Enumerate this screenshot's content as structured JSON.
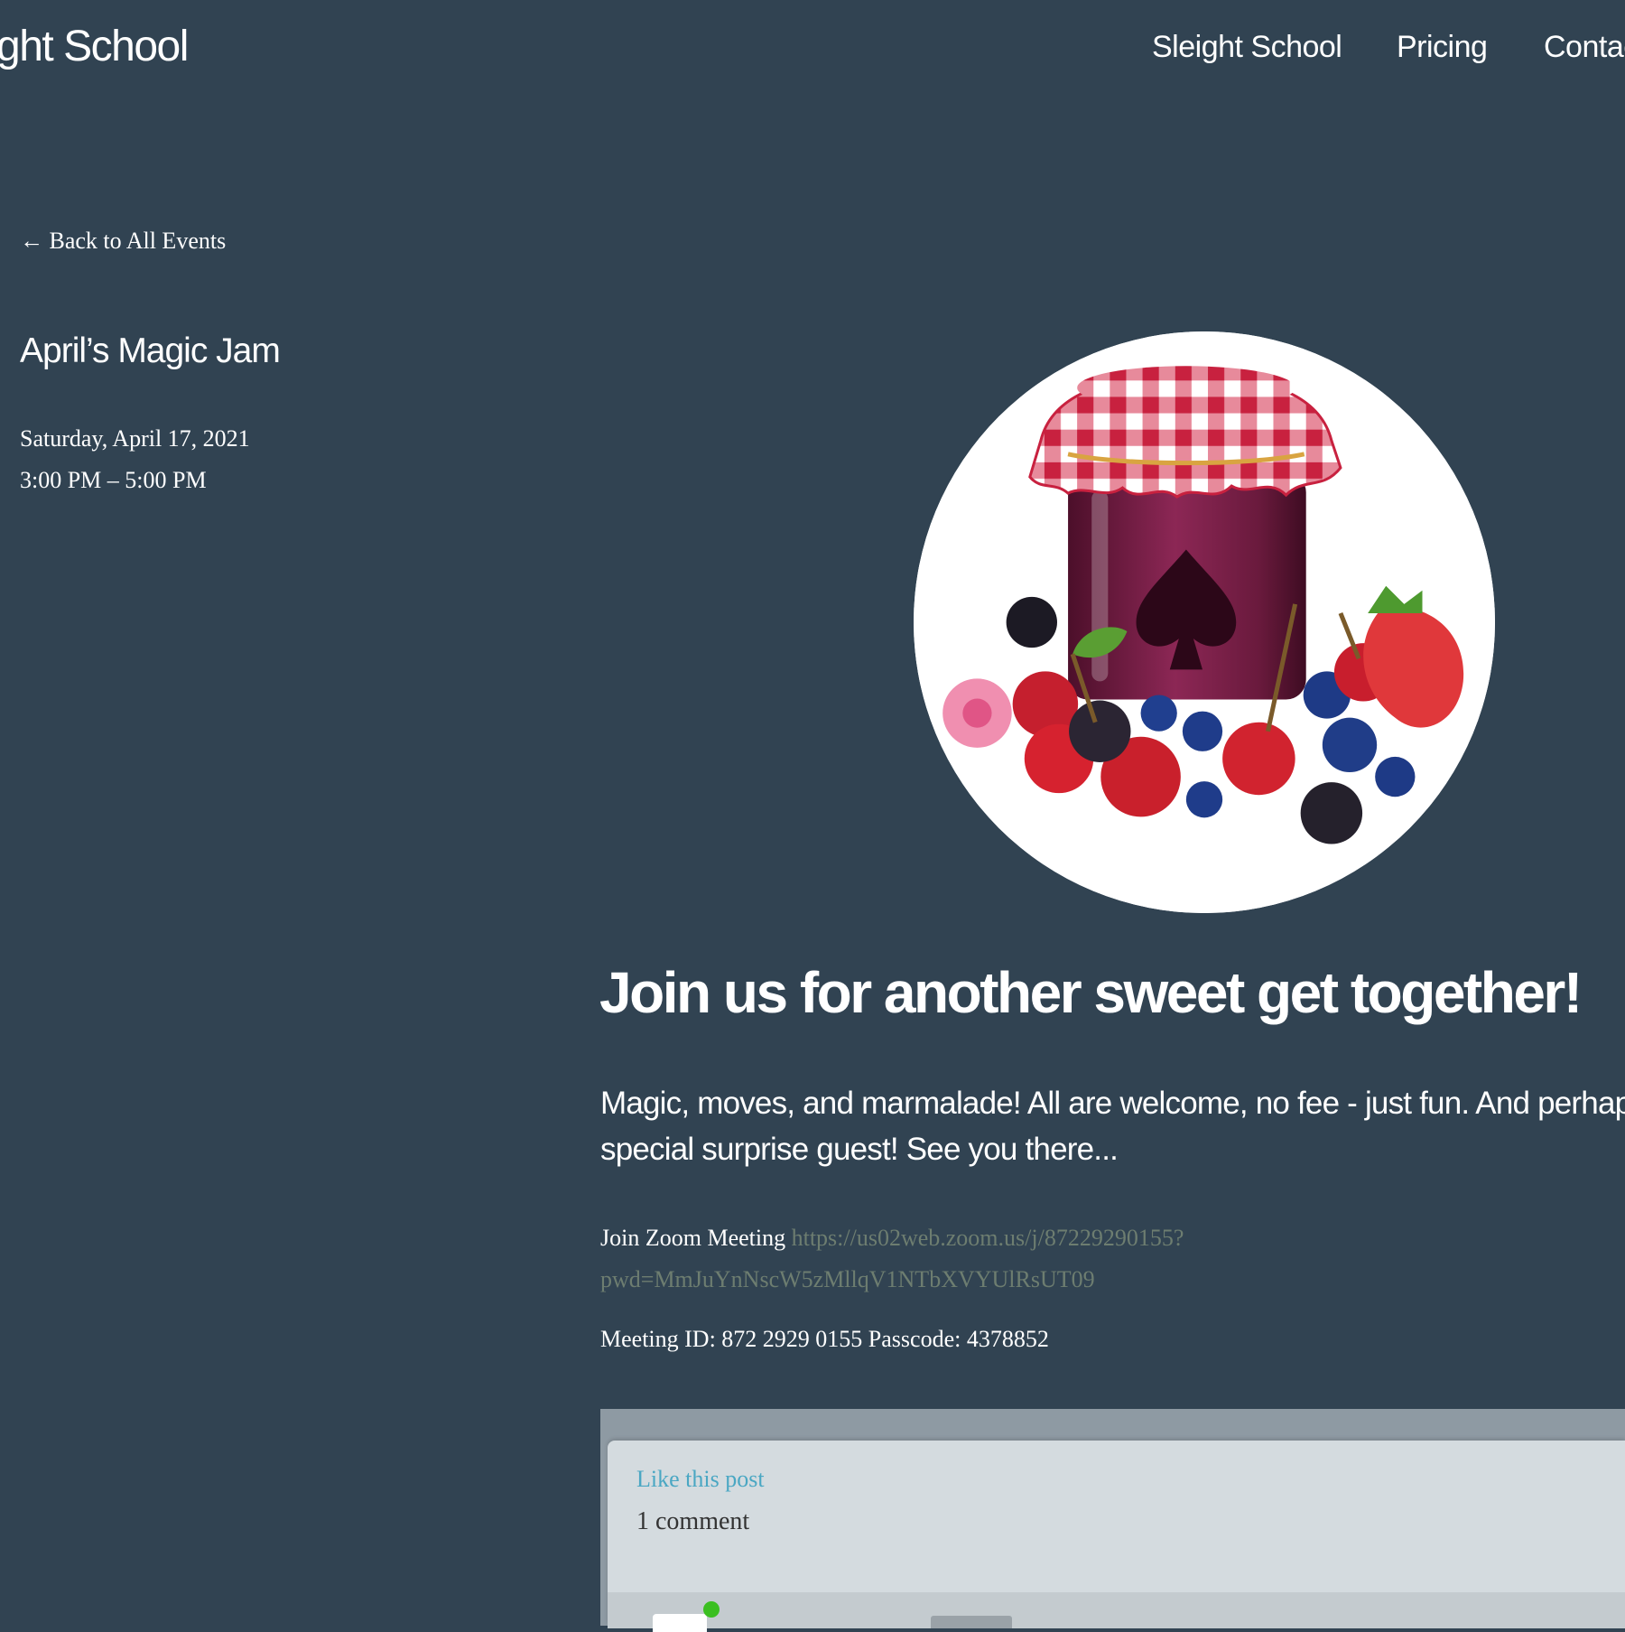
{
  "header": {
    "logo": "Sleight School",
    "nav": [
      "Sleight School",
      "Pricing",
      "Contact"
    ]
  },
  "event": {
    "back_link": "← Back to All Events",
    "title": "April’s Magic Jam",
    "date": "Saturday, April 17, 2021",
    "time": "3:00 PM – 5:00 PM"
  },
  "hero_image": {
    "icon": "jam-jar-spade-icon"
  },
  "content": {
    "heading": "Join us for another sweet get together!",
    "intro": "Magic, moves, and marmalade! All are welcome, no fee - just fun. And perhaps a special surprise guest! See you there...",
    "zoom_label": "Join Zoom Meeting",
    "zoom_url": "https://us02web.zoom.us/j/87229290155?pwd=MmJuYnNscW5zMllqV1NTbXVYUlRsUT09",
    "meeting_info": "Meeting ID: 872 2929 0155 Passcode: 4378852"
  },
  "comments": {
    "like_label": "Like this post",
    "count_label": "1 comment"
  },
  "colors": {
    "background": "#314352",
    "link_muted": "#6d7d70",
    "like_link": "#4aa7c3",
    "card": "#d4dbdf"
  }
}
